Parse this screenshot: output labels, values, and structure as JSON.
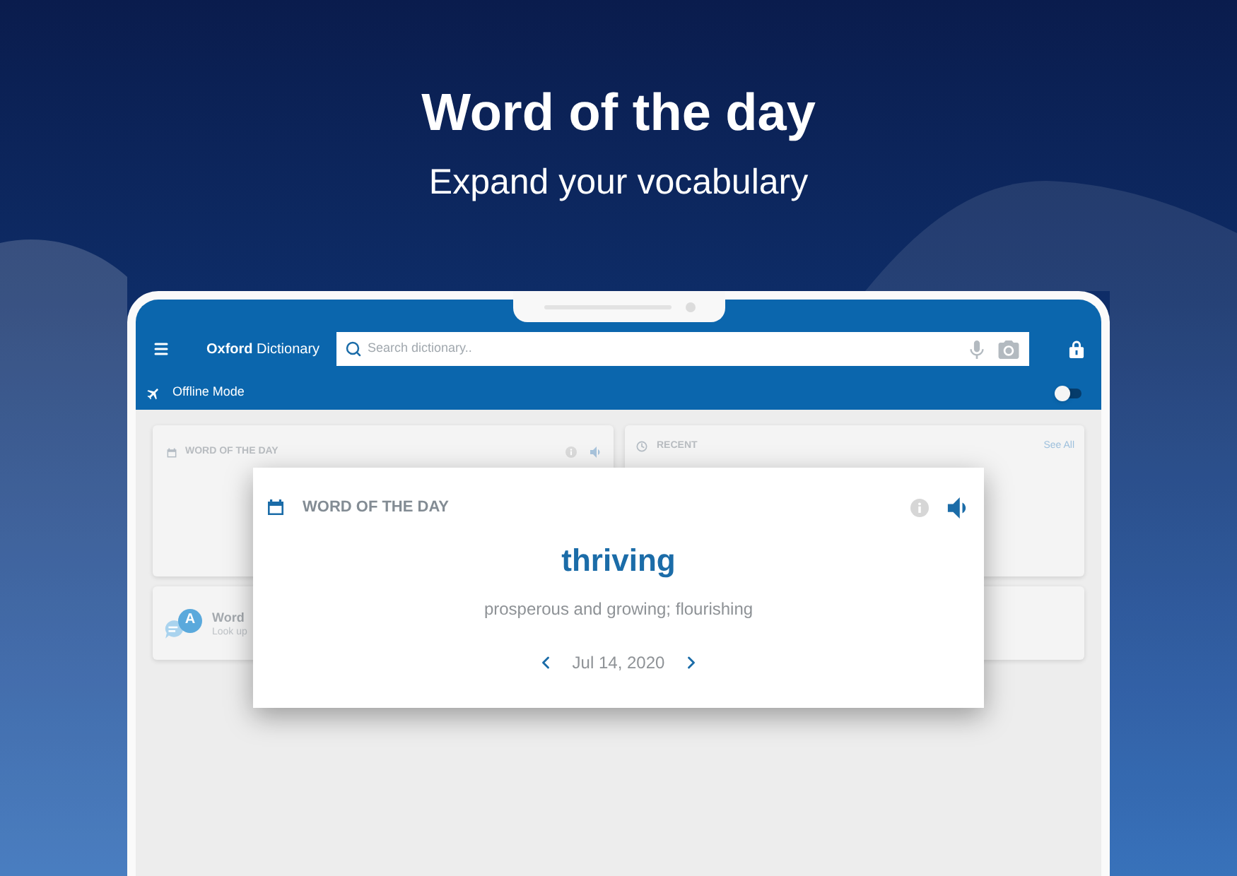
{
  "hero": {
    "title": "Word of the day",
    "subtitle": "Expand your vocabulary"
  },
  "app_bar": {
    "brand": "**Oxford** Dictionary",
    "search": {
      "placeholder": "Search dictionary.."
    },
    "offline_mode": {
      "label": "Offline Mode",
      "on": false
    }
  },
  "cards": [
    {
      "kind": "word_of_the_day",
      "title": "WORD OF THE DAY"
    },
    {
      "kind": "recent",
      "title": "RECENT",
      "link": "See All"
    },
    {
      "kind": "feature",
      "badge": "A",
      "title": "Word",
      "subtitle": "Look up"
    },
    {
      "kind": "blank"
    }
  ],
  "popup": {
    "title": "WORD OF THE DAY",
    "word": "thriving",
    "definition": "prosperous and growing; flourishing",
    "date": "Jul 14, 2020"
  }
}
